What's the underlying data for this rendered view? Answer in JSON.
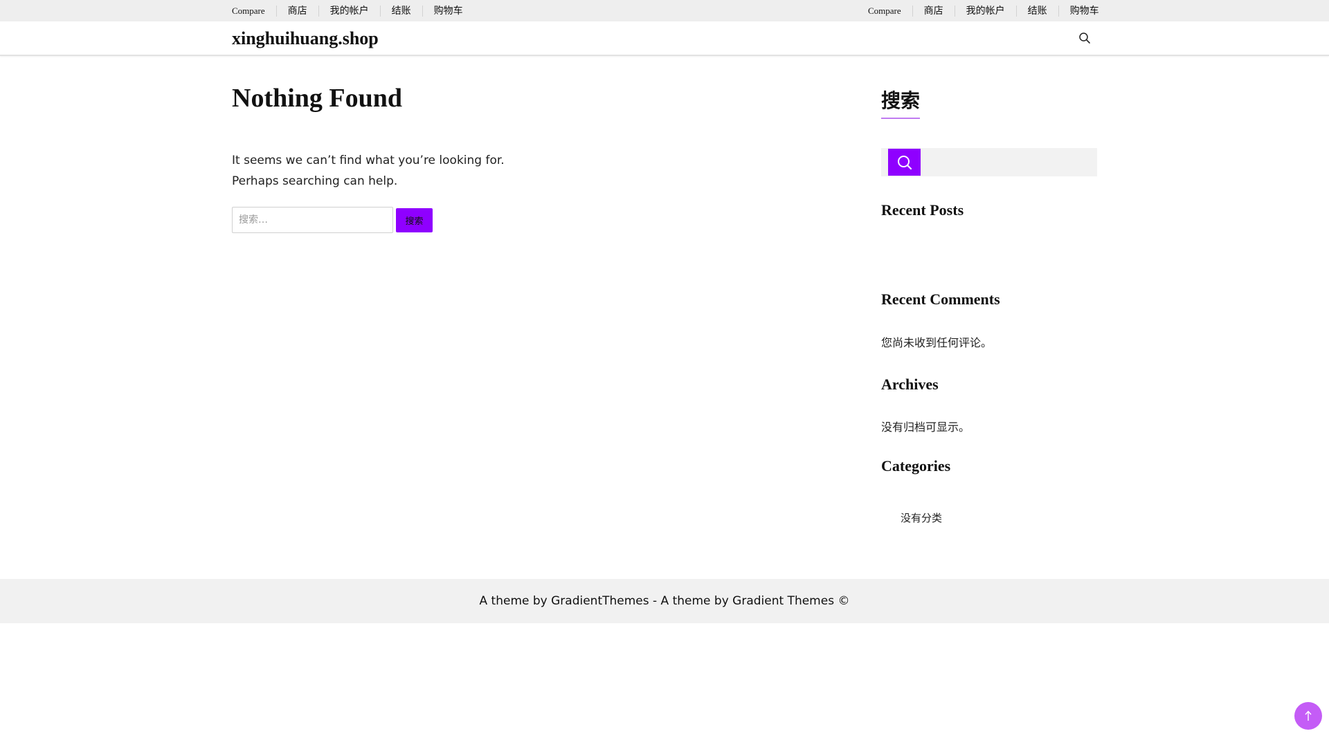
{
  "top_nav": {
    "left": [
      "Compare",
      "商店",
      "我的帐户",
      "结账",
      "购物车"
    ],
    "right": [
      "Compare",
      "商店",
      "我的帐户",
      "结账",
      "购物车"
    ]
  },
  "header": {
    "site_title": "xinghuihuang.shop"
  },
  "main": {
    "title": "Nothing Found",
    "intro": "It seems we can’t find what you’re looking for. Perhaps searching can help.",
    "search_placeholder": "搜索…",
    "search_button": "搜索"
  },
  "sidebar": {
    "search_title": "搜索",
    "search_value": "",
    "recent_posts_title": "Recent Posts",
    "recent_comments_title": "Recent Comments",
    "recent_comments_text": "您尚未收到任何评论。",
    "archives_title": "Archives",
    "archives_text": "没有归档可显示。",
    "categories_title": "Categories",
    "categories_items": [
      "没有分类"
    ]
  },
  "footer": {
    "text": "A theme by GradientThemes - A theme by Gradient Themes ©"
  },
  "colors": {
    "accent": "#8f00ff",
    "back_to_top": "#c45cf6"
  },
  "icons": {
    "header_search": "search-icon",
    "sidebar_search": "search-icon",
    "back_to_top": "arrow-up-icon"
  }
}
